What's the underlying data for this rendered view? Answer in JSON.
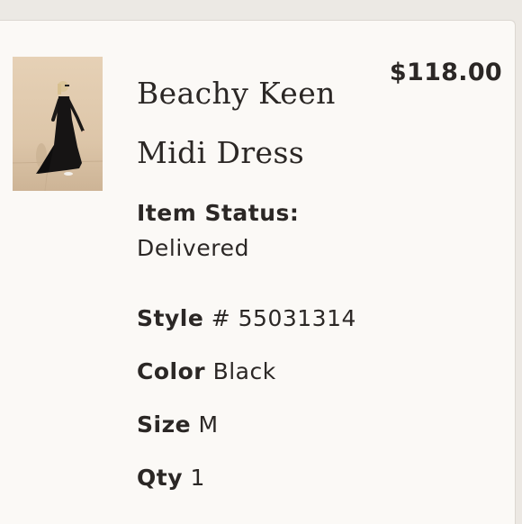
{
  "product": {
    "name": "Beachy Keen Midi Dress",
    "price": "$118.00",
    "image_alt": "Model wearing black midi dress"
  },
  "status": {
    "label": "Item Status:",
    "value": "Delivered"
  },
  "details": {
    "style_label": "Style",
    "style_value": "# 55031314",
    "color_label": "Color",
    "color_value": "Black",
    "size_label": "Size",
    "size_value": "M",
    "qty_label": "Qty",
    "qty_value": "1"
  }
}
